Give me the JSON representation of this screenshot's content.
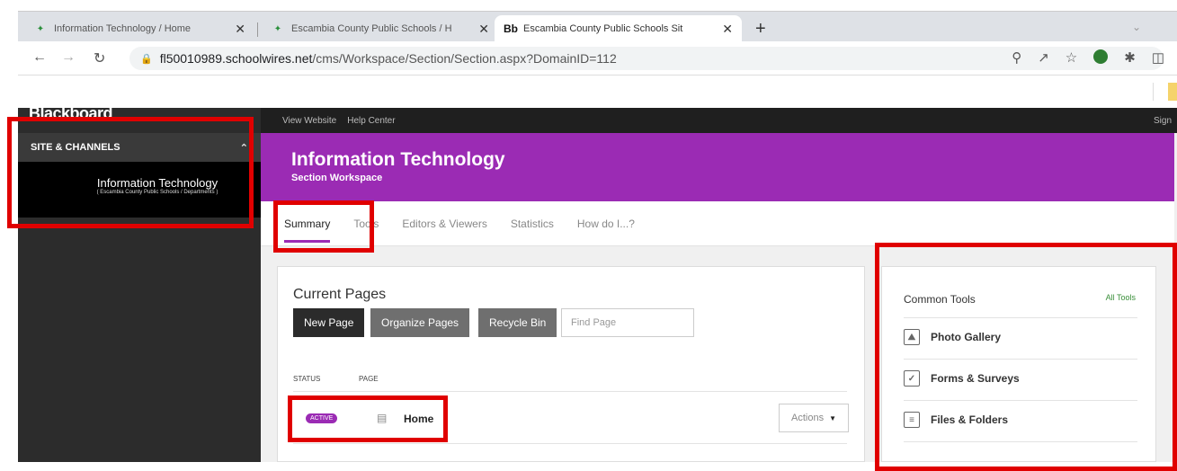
{
  "browser": {
    "tabs": [
      {
        "title": "Information Technology / Home"
      },
      {
        "title": "Escambia County Public Schools / H"
      },
      {
        "title": "Escambia County Public Schools Sit",
        "prefix": "Bb"
      }
    ],
    "new_tab": "+",
    "url_host": "fl50010989.schoolwires.net",
    "url_path": "/cms/Workspace/Section/Section.aspx?DomainID=112"
  },
  "sidebar": {
    "logo": "Blackboard",
    "header": "SITE & CHANNELS",
    "item_title": "Information Technology",
    "item_path": "( Escambia County Public Schools / Departments )"
  },
  "topnav": {
    "view_website": "View Website",
    "help_center": "Help Center",
    "sign": "Sign"
  },
  "banner": {
    "title": "Information Technology",
    "subtitle": "Section Workspace"
  },
  "tabs": [
    "Summary",
    "Tools",
    "Editors & Viewers",
    "Statistics",
    "How do I...?"
  ],
  "current_pages": {
    "heading": "Current Pages",
    "new_page": "New Page",
    "organize_pages": "Organize Pages",
    "recycle_bin": "Recycle Bin",
    "find_placeholder": "Find Page",
    "col_status": "STATUS",
    "col_page": "PAGE",
    "row": {
      "status": "ACTIVE",
      "name": "Home",
      "actions": "Actions"
    }
  },
  "common_tools": {
    "heading": "Common Tools",
    "all_tools": "All Tools",
    "items": [
      "Photo Gallery",
      "Forms & Surveys",
      "Files & Folders"
    ]
  }
}
